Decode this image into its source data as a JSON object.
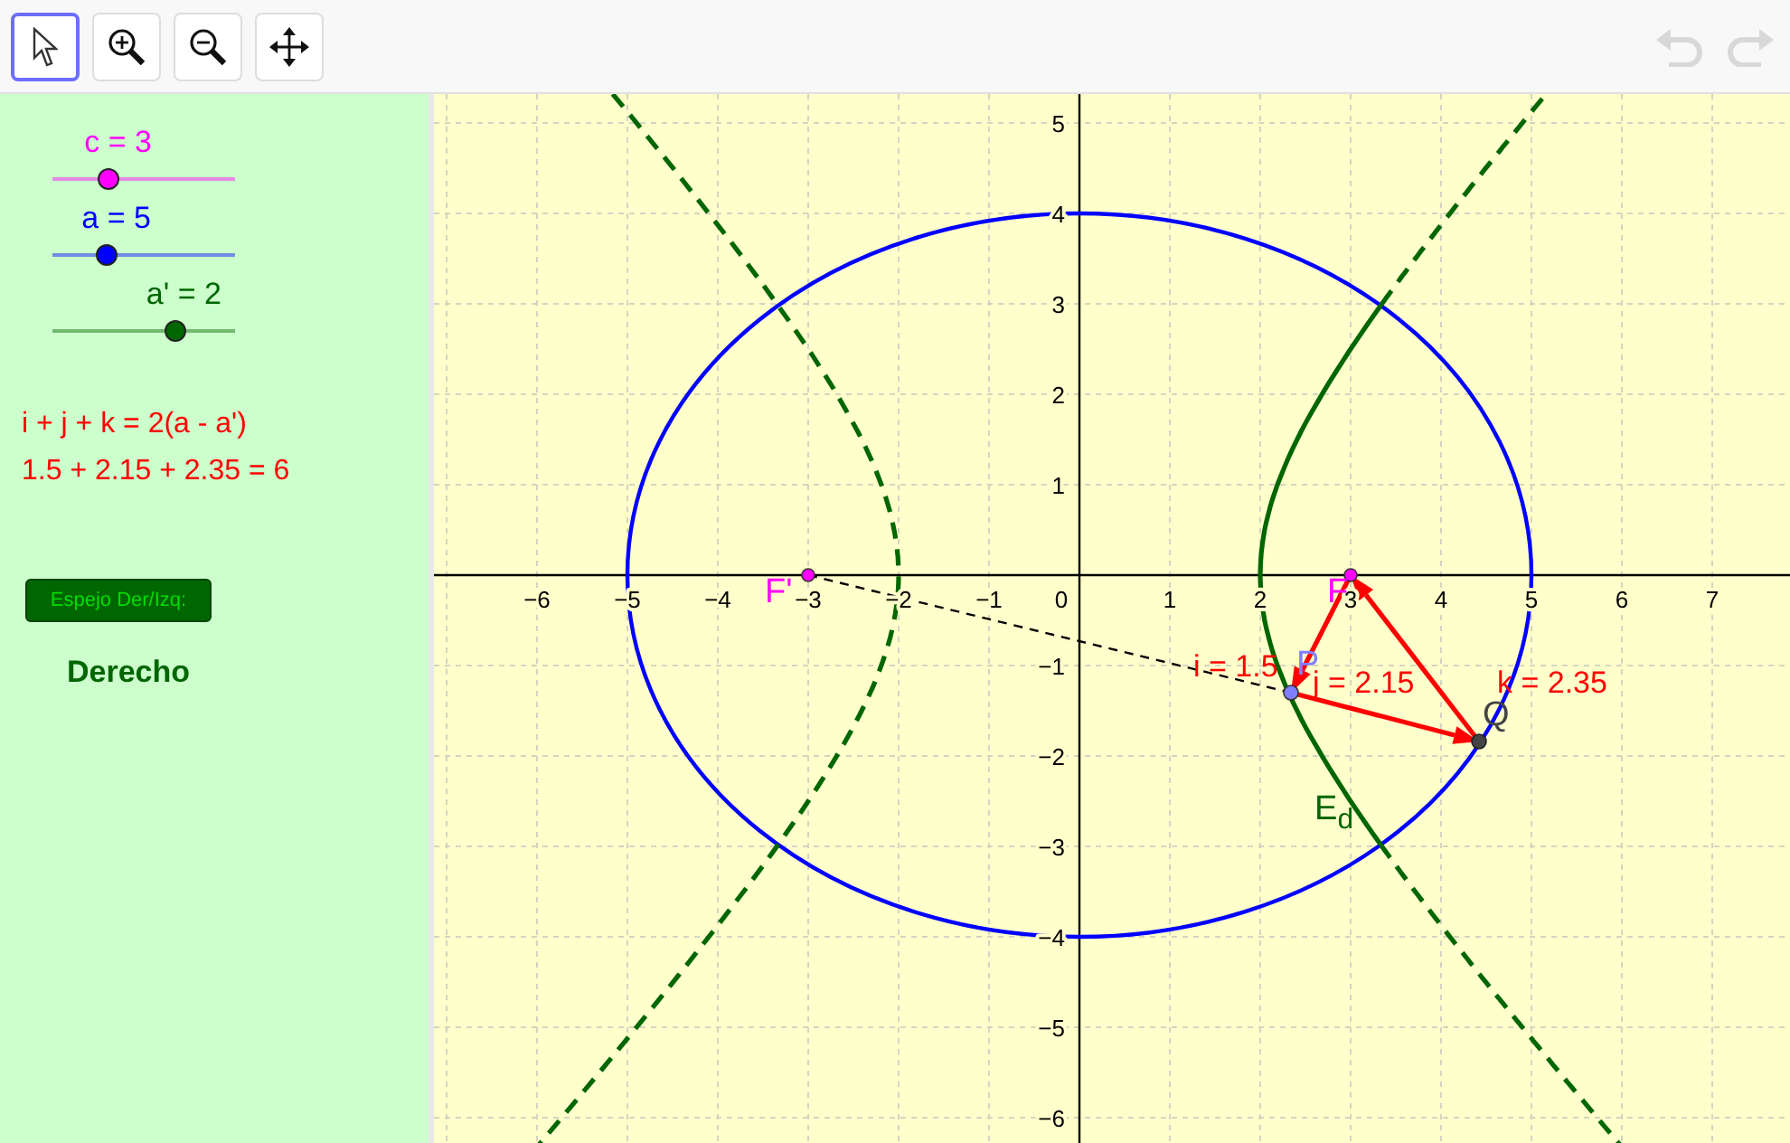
{
  "toolbar": {
    "tools": [
      {
        "kind": "pointer",
        "selected": true
      },
      {
        "kind": "zoom-in",
        "selected": false
      },
      {
        "kind": "zoom-out",
        "selected": false
      },
      {
        "kind": "move",
        "selected": false
      }
    ],
    "history": [
      {
        "kind": "undo",
        "disabled": true
      },
      {
        "kind": "redo",
        "disabled": true
      }
    ]
  },
  "sliders": [
    {
      "label": "c = 3",
      "color": "#ff00ff",
      "level": 0.31
    },
    {
      "label": "a = 5",
      "color": "#0000ff",
      "level": 0.3
    },
    {
      "label": "a' = 2",
      "color": "#006600",
      "level": 0.67
    }
  ],
  "equations": [
    "i + j + k = 2(a - a')",
    "1.5 + 2.15 + 2.35 = 6"
  ],
  "mirror_button": "Espejo Der/Izq:",
  "mirror_state": "Derecho",
  "graph": {
    "x_ticks": [
      "−6",
      "−5",
      "−4",
      "−3",
      "−2",
      "−1",
      "0",
      "1",
      "2",
      "3",
      "4",
      "5",
      "6",
      "7"
    ],
    "y_ticks": [
      "5",
      "4",
      "3",
      "2",
      "1",
      "−1",
      "−2",
      "−3",
      "−4",
      "−5",
      "−6"
    ],
    "labels": [
      {
        "kind": "focus-left",
        "text": "F'"
      },
      {
        "kind": "focus-right",
        "text": "F"
      },
      {
        "kind": "point-p",
        "text": "P"
      },
      {
        "kind": "point-q",
        "text": "Q"
      },
      {
        "kind": "segment-i",
        "text": "i = 1.5"
      },
      {
        "kind": "segment-j",
        "text": "j = 2.15"
      },
      {
        "kind": "segment-k",
        "text": "k = 2.35"
      },
      {
        "kind": "curve",
        "text": "E$_{d}$"
      }
    ]
  }
}
